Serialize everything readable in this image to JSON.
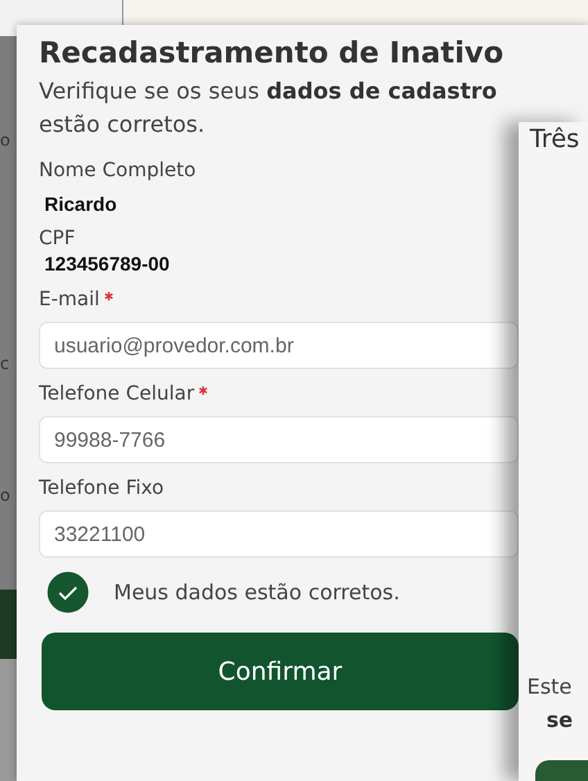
{
  "background": {
    "fragments": [
      "o",
      "c",
      "o"
    ]
  },
  "modal": {
    "title": "Recadastramento de Inativo",
    "subtitle": "Verifique se os seus **dados de cadastro** estão corretos.",
    "readonly_fields": [
      {
        "label": "Nome Completo",
        "value": "Ricardo"
      },
      {
        "label": "CPF",
        "value": "123456789-00"
      }
    ],
    "inputs": [
      {
        "label": "E-mail",
        "required": true,
        "value": "usuario@provedor.com.br"
      },
      {
        "label": "Telefone Celular",
        "required": true,
        "value": "99988-7766"
      },
      {
        "label": "Telefone Fixo",
        "required": false,
        "value": "33221100"
      }
    ],
    "confirmation": {
      "label": "Meus dados estão corretos.",
      "checked": true
    },
    "button": "Confirmar"
  },
  "back_card": {
    "title": "Três",
    "text_1": "Este",
    "text_2": "se"
  }
}
